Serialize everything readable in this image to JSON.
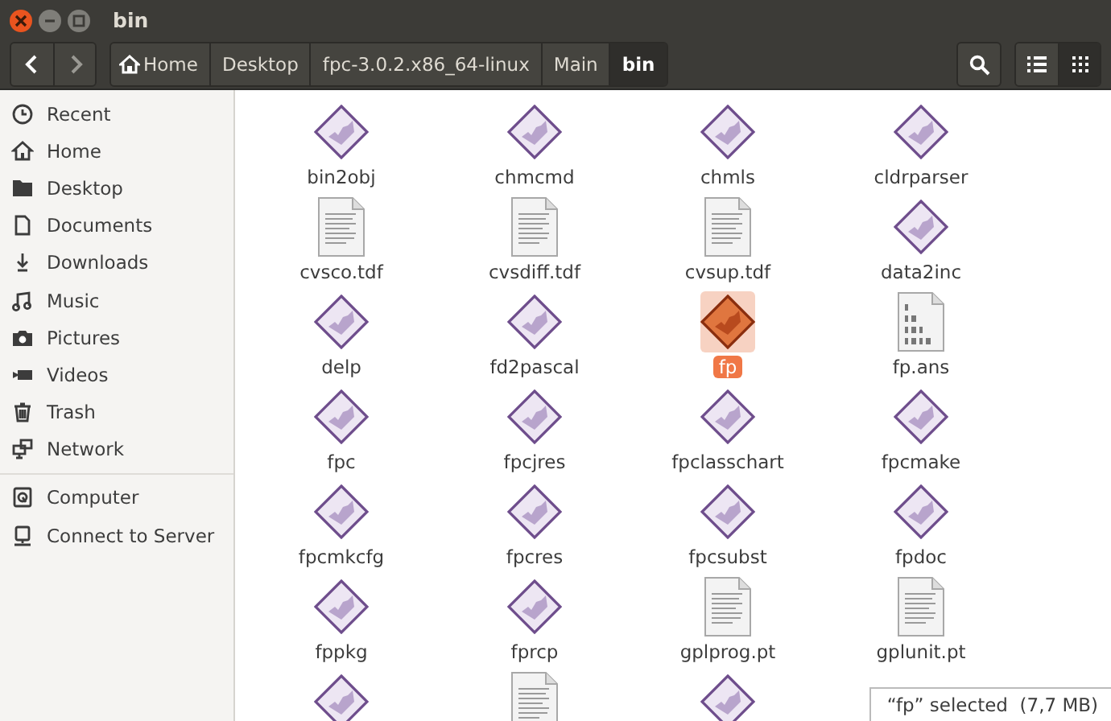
{
  "window": {
    "title": "bin"
  },
  "breadcrumbs": [
    {
      "label": "Home",
      "kind": "home",
      "selected": false
    },
    {
      "label": "Desktop",
      "kind": "plain",
      "selected": false
    },
    {
      "label": "fpc-3.0.2.x86_64-linux",
      "kind": "plain",
      "selected": false
    },
    {
      "label": "Main",
      "kind": "plain",
      "selected": false
    },
    {
      "label": "bin",
      "kind": "plain",
      "selected": true
    }
  ],
  "view_buttons": [
    {
      "kind": "list",
      "selected": false
    },
    {
      "kind": "grid",
      "selected": true
    }
  ],
  "sidebar": {
    "groups": [
      [
        {
          "label": "Recent",
          "kind": "recent"
        },
        {
          "label": "Home",
          "kind": "home"
        },
        {
          "label": "Desktop",
          "kind": "folder"
        },
        {
          "label": "Documents",
          "kind": "document"
        },
        {
          "label": "Downloads",
          "kind": "download"
        },
        {
          "label": "Music",
          "kind": "music"
        },
        {
          "label": "Pictures",
          "kind": "camera"
        },
        {
          "label": "Videos",
          "kind": "video"
        },
        {
          "label": "Trash",
          "kind": "trash"
        },
        {
          "label": "Network",
          "kind": "network"
        }
      ],
      [
        {
          "label": "Computer",
          "kind": "drive"
        },
        {
          "label": "Connect to Server",
          "kind": "server"
        }
      ]
    ]
  },
  "files": [
    {
      "name": "bin2obj",
      "kind": "exec",
      "selected": false
    },
    {
      "name": "chmcmd",
      "kind": "exec",
      "selected": false
    },
    {
      "name": "chmls",
      "kind": "exec",
      "selected": false
    },
    {
      "name": "cldrparser",
      "kind": "exec",
      "selected": false
    },
    {
      "name": "cvsco.tdf",
      "kind": "text",
      "selected": false
    },
    {
      "name": "cvsdiff.tdf",
      "kind": "text",
      "selected": false
    },
    {
      "name": "cvsup.tdf",
      "kind": "text",
      "selected": false
    },
    {
      "name": "data2inc",
      "kind": "exec",
      "selected": false
    },
    {
      "name": "delp",
      "kind": "exec",
      "selected": false
    },
    {
      "name": "fd2pascal",
      "kind": "exec",
      "selected": false
    },
    {
      "name": "fp",
      "kind": "exec",
      "selected": true
    },
    {
      "name": "fp.ans",
      "kind": "binary",
      "selected": false
    },
    {
      "name": "fpc",
      "kind": "exec",
      "selected": false
    },
    {
      "name": "fpcjres",
      "kind": "exec",
      "selected": false
    },
    {
      "name": "fpclasschart",
      "kind": "exec",
      "selected": false
    },
    {
      "name": "fpcmake",
      "kind": "exec",
      "selected": false
    },
    {
      "name": "fpcmkcfg",
      "kind": "exec",
      "selected": false
    },
    {
      "name": "fpcres",
      "kind": "exec",
      "selected": false
    },
    {
      "name": "fpcsubst",
      "kind": "exec",
      "selected": false
    },
    {
      "name": "fpdoc",
      "kind": "exec",
      "selected": false
    },
    {
      "name": "fppkg",
      "kind": "exec",
      "selected": false
    },
    {
      "name": "fprcp",
      "kind": "exec",
      "selected": false
    },
    {
      "name": "gplprog.pt",
      "kind": "text",
      "selected": false
    },
    {
      "name": "gplunit.pt",
      "kind": "text",
      "selected": false
    },
    {
      "kind": "exec",
      "selected": false
    },
    {
      "kind": "text",
      "selected": false
    },
    {
      "kind": "exec",
      "selected": false
    }
  ],
  "status_bar": {
    "text": "“fp” selected  (7,7 MB)"
  }
}
